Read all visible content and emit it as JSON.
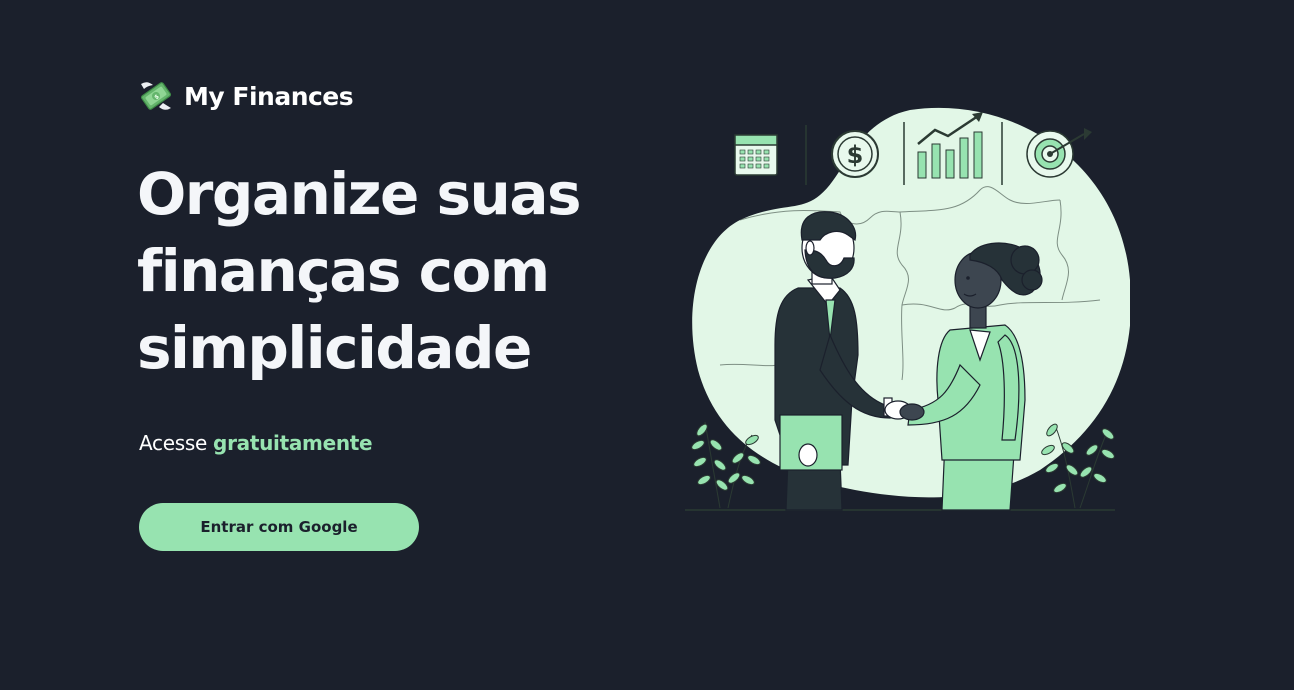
{
  "brand": {
    "name": "My Finances",
    "logo_icon": "money-with-wings-icon"
  },
  "hero": {
    "headline_lines": [
      "Organize suas",
      "finanças com",
      "simplicidade"
    ],
    "subtitle_prefix": "Acesse",
    "subtitle_highlight": "gratuitamente"
  },
  "actions": {
    "login_button_label": "Entrar com Google"
  },
  "illustration": {
    "icons": [
      "calendar-icon",
      "dollar-coin-icon",
      "growth-chart-icon",
      "target-icon"
    ],
    "subject": "business-handshake"
  },
  "colors": {
    "background": "#1b202c",
    "accent": "#97e3b0",
    "text": "#ffffff",
    "illustration_bg": "#e2f7e7"
  }
}
